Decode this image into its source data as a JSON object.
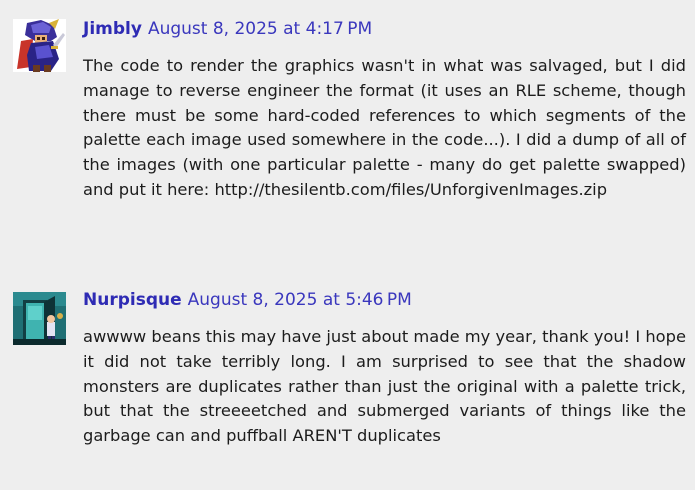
{
  "comments": [
    {
      "author": "Jimbly",
      "date": "August 8, 2025 at 4:17 PM",
      "avatar_icon": "knight-sprite-avatar-icon",
      "body": "The code to render the graphics wasn't in what was salvaged, but I did manage to reverse engineer the format (it uses an RLE scheme, though there must be some hard-coded references to which segments of the palette each image used somewhere in the code...). I did a dump of all of the images (with one particular palette - many do get palette swapped) and put it here: http://thesilentb.com/files/UnforgivenImages.zip"
    },
    {
      "author": "Nurpisque",
      "date": "August 8, 2025 at 5:46 PM",
      "avatar_icon": "teal-door-scene-avatar-icon",
      "body": "awwww beans this may have just about made my year, thank you! I hope it did not take terribly long. I am surprised to see that the shadow monsters are duplicates rather than just the original with a palette trick, but that the streeeetched and submerged variants of things like the garbage can and puffball AREN'T duplicates"
    }
  ],
  "colors": {
    "background": "#eeeeee",
    "author": "#2e2bb4",
    "date": "#3a37bd",
    "text": "#1c1c1c"
  }
}
